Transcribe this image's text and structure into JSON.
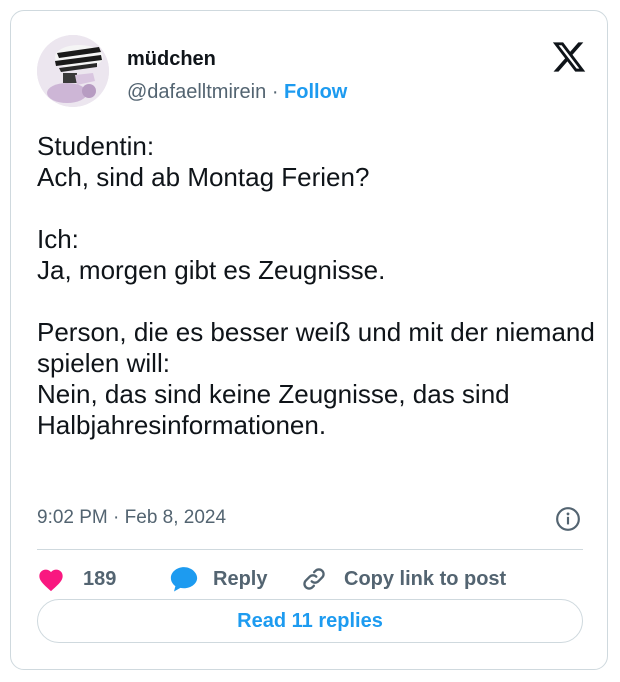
{
  "author": {
    "display_name": "müdchen",
    "handle": "@dafaelltmirein",
    "separator": "·",
    "follow_label": "Follow"
  },
  "tweet": {
    "text": "Studentin:\nAch, sind ab Montag Ferien?\n\nIch:\nJa, morgen gibt es Zeugnisse.\n\nPerson, die es besser weiß und mit der niemand spielen will:\nNein, das sind keine Zeugnisse, das sind Halbjahresinformationen.",
    "time": "9:02 PM",
    "separator": "·",
    "date": "Feb 8, 2024"
  },
  "actions": {
    "like_count": "189",
    "reply_label": "Reply",
    "copy_label": "Copy link to post"
  },
  "read_replies_label": "Read 11 replies",
  "icons": {
    "logo": "x-logo-icon",
    "info": "info-icon",
    "like": "heart-icon",
    "reply": "speech-bubble-icon",
    "copy": "link-icon"
  },
  "colors": {
    "accent": "#1d9bf0",
    "like": "#f91880",
    "text": "#0f1419",
    "muted": "#536471",
    "border": "#cfd9de"
  }
}
